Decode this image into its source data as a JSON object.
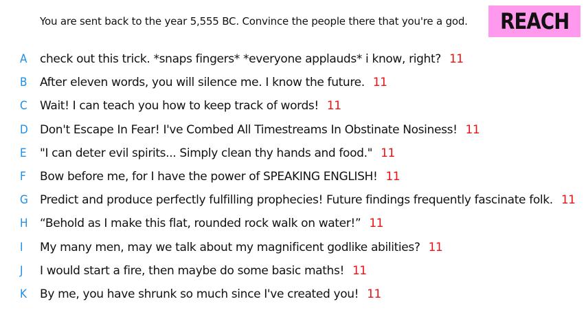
{
  "prompt": "You are sent back to the year 5,555 BC. Convince the people there that you're a god.",
  "badge": "REACH",
  "colors": {
    "letter": "#1f8fe6",
    "score": "#ee1111",
    "badge_bg": "#ff99ee",
    "text": "#111111"
  },
  "answers": [
    {
      "letter": "A",
      "text": "check out this trick. *snaps fingers* *everyone applauds* i know, right?",
      "score": "11"
    },
    {
      "letter": "B",
      "text": "After eleven words, you will silence me. I know the future.",
      "score": "11"
    },
    {
      "letter": "C",
      "text": "Wait! I can teach you how to keep track of words!",
      "score": "11"
    },
    {
      "letter": "D",
      "text": "Don't Escape In Fear! I've Combed All Timestreams In Obstinate Nosiness!",
      "score": "11"
    },
    {
      "letter": "E",
      "text": "\"I can deter evil spirits... Simply clean thy hands and food.\"",
      "score": "11"
    },
    {
      "letter": "F",
      "text": "Bow before me, for I have the power of SPEAKING ENGLISH!",
      "score": "11"
    },
    {
      "letter": "G",
      "text": "Predict and produce perfectly fulfilling prophecies! Future findings frequently fascinate folk.",
      "score": "11"
    },
    {
      "letter": "H",
      "text": "“Behold as I make this flat, rounded rock walk on water!”",
      "score": "11"
    },
    {
      "letter": "I",
      "text": "My many men, may we talk about my magnificent godlike abilities?",
      "score": "11"
    },
    {
      "letter": "J",
      "text": "I would start a fire, then maybe do some basic maths!",
      "score": "11"
    },
    {
      "letter": "K",
      "text": "By me, you have shrunk so much since I've created you!",
      "score": "11"
    }
  ]
}
